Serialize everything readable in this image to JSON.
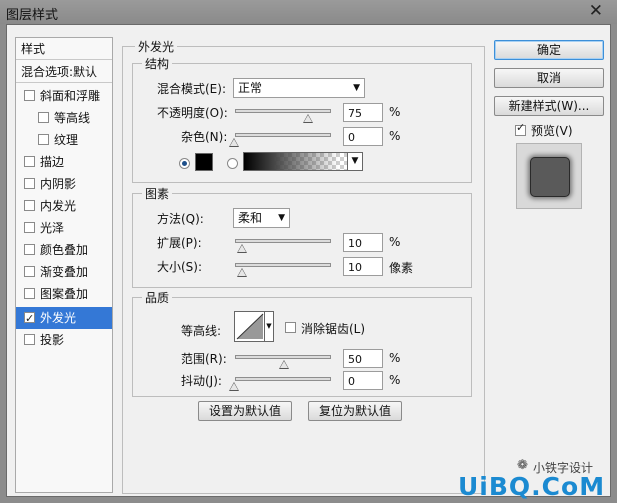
{
  "window": {
    "title": "图层样式"
  },
  "sidebar": {
    "header": "样式",
    "blend_options": "混合选项:默认",
    "items": [
      {
        "label": "斜面和浮雕",
        "checked": false
      },
      {
        "label": "等高线",
        "checked": false
      },
      {
        "label": "纹理",
        "checked": false
      },
      {
        "label": "描边",
        "checked": false
      },
      {
        "label": "内阴影",
        "checked": false
      },
      {
        "label": "内发光",
        "checked": false
      },
      {
        "label": "光泽",
        "checked": false
      },
      {
        "label": "颜色叠加",
        "checked": false
      },
      {
        "label": "渐变叠加",
        "checked": false
      },
      {
        "label": "图案叠加",
        "checked": false
      },
      {
        "label": "外发光",
        "checked": true
      },
      {
        "label": "投影",
        "checked": false
      }
    ]
  },
  "panel": {
    "title": "外发光"
  },
  "structure": {
    "title": "结构",
    "blend_label": "混合模式(E):",
    "blend_value": "正常",
    "opacity_label": "不透明度(O):",
    "opacity_value": "75",
    "opacity_unit": "%",
    "noise_label": "杂色(N):",
    "noise_value": "0",
    "noise_unit": "%",
    "color_swatch": "#000000"
  },
  "elements": {
    "title": "图素",
    "method_label": "方法(Q):",
    "method_value": "柔和",
    "spread_label": "扩展(P):",
    "spread_value": "10",
    "spread_unit": "%",
    "size_label": "大小(S):",
    "size_value": "10",
    "size_unit": "像素"
  },
  "quality": {
    "title": "品质",
    "contour_label": "等高线:",
    "antialias_label": "消除锯齿(L)",
    "range_label": "范围(R):",
    "range_value": "50",
    "range_unit": "%",
    "jitter_label": "抖动(J):",
    "jitter_value": "0",
    "jitter_unit": "%"
  },
  "buttons": {
    "make_default": "设置为默认值",
    "reset_default": "复位为默认值",
    "ok": "确定",
    "cancel": "取消",
    "new_style": "新建样式(W)...",
    "preview": "预览(V)"
  },
  "watermark": {
    "wechat": "小铁字设计",
    "site": "UiBQ.CoM"
  }
}
